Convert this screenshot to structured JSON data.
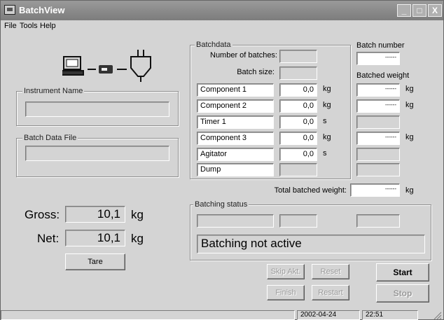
{
  "window": {
    "title": "BatchView",
    "buttons": {
      "minimize": "_",
      "maximize": "□",
      "close": "X"
    }
  },
  "menu": {
    "items": [
      "File",
      "Tools",
      "Help"
    ]
  },
  "instrument": {
    "group_label": "Instrument Name",
    "value": ""
  },
  "batch_data_file": {
    "group_label": "Batch Data File",
    "value": ""
  },
  "weights": {
    "gross_label": "Gross:",
    "gross_value": "10,1",
    "gross_unit": "kg",
    "net_label": "Net:",
    "net_value": "10,1",
    "net_unit": "kg",
    "tare_button": "Tare"
  },
  "batchdata": {
    "group_label": "Batchdata",
    "num_batches_label": "Number of batches:",
    "batch_size_label": "Batch size:",
    "rows": [
      {
        "name": "Component 1",
        "value": "0,0",
        "unit": "kg",
        "weighed": "------",
        "weighed_unit": "kg"
      },
      {
        "name": "Component 2",
        "value": "0,0",
        "unit": "kg",
        "weighed": "------",
        "weighed_unit": "kg"
      },
      {
        "name": "Timer 1",
        "value": "0,0",
        "unit": "s",
        "weighed": "",
        "weighed_unit": ""
      },
      {
        "name": "Component 3",
        "value": "0,0",
        "unit": "kg",
        "weighed": "------",
        "weighed_unit": "kg"
      },
      {
        "name": "Agitator",
        "value": "0,0",
        "unit": "s",
        "weighed": "",
        "weighed_unit": ""
      },
      {
        "name": "Dump",
        "value": "",
        "unit": "",
        "weighed": "",
        "weighed_unit": ""
      }
    ]
  },
  "batch_number": {
    "label": "Batch number",
    "value": "------"
  },
  "batched_weight": {
    "label": "Batched weight"
  },
  "total": {
    "label": "Total batched weight:",
    "value": "------",
    "unit": "kg"
  },
  "batching_status": {
    "group_label": "Batching status",
    "message": "Batching not active"
  },
  "buttons": {
    "skip": "Skip Akt.",
    "reset": "Reset",
    "start": "Start",
    "finish": "Finish",
    "restart": "Restart",
    "stop": "Stop"
  },
  "status_bar": {
    "date": "2002-04-24",
    "time": "22:51"
  }
}
